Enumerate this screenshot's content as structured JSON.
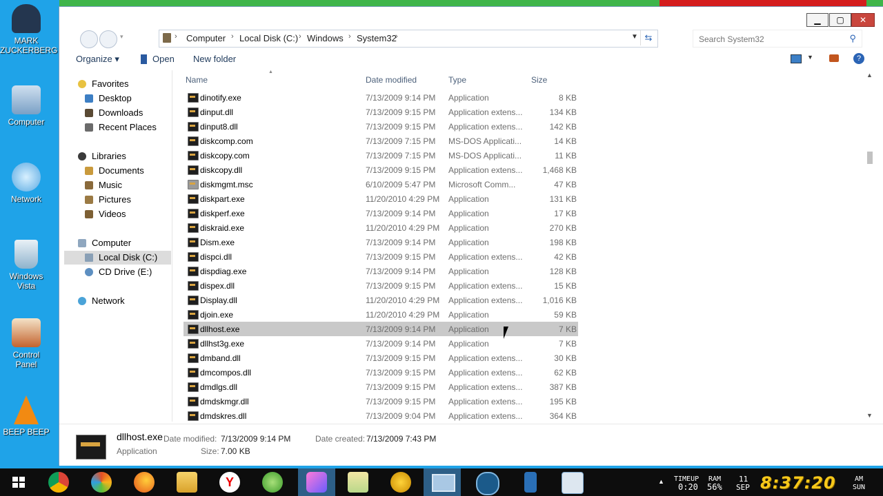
{
  "desktop": {
    "icons": [
      {
        "label": "MARK\nZUCKERBERG",
        "icon": "person-icon"
      },
      {
        "label": "Computer",
        "icon": "computer-icon"
      },
      {
        "label": "Network",
        "icon": "network-icon"
      },
      {
        "label": "Windows\nVista",
        "icon": "recycle-bin-icon"
      },
      {
        "label": "Control\nPanel",
        "icon": "control-panel-icon"
      },
      {
        "label": "BEEP BEEP",
        "icon": "cone-icon"
      }
    ]
  },
  "window": {
    "buttons": {
      "minimize": "▁",
      "maximize": "▢",
      "close": "✕"
    },
    "breadcrumb": [
      "Computer",
      "Local Disk (C:)",
      "Windows",
      "System32"
    ],
    "search_placeholder": "Search System32",
    "toolbar": {
      "organize": "Organize ▾",
      "open": "Open",
      "new_folder": "New folder"
    }
  },
  "sidebar": {
    "items": [
      {
        "label": "Favorites",
        "icon": "star-icon",
        "indent": 0
      },
      {
        "label": "Desktop",
        "icon": "desktop-icon",
        "indent": 1
      },
      {
        "label": "Downloads",
        "icon": "downloads-icon",
        "indent": 1
      },
      {
        "label": "Recent Places",
        "icon": "recent-places-icon",
        "indent": 1
      },
      {
        "label": "Libraries",
        "icon": "libraries-icon",
        "indent": 0
      },
      {
        "label": "Documents",
        "icon": "documents-icon",
        "indent": 1
      },
      {
        "label": "Music",
        "icon": "music-icon",
        "indent": 1
      },
      {
        "label": "Pictures",
        "icon": "pictures-icon",
        "indent": 1
      },
      {
        "label": "Videos",
        "icon": "videos-icon",
        "indent": 1
      },
      {
        "label": "Computer",
        "icon": "computer-icon",
        "indent": 0
      },
      {
        "label": "Local Disk (C:)",
        "icon": "drive-icon",
        "indent": 1,
        "selected": true
      },
      {
        "label": "CD Drive (E:)",
        "icon": "cd-drive-icon",
        "indent": 1
      },
      {
        "label": "Network",
        "icon": "network-icon",
        "indent": 0
      }
    ]
  },
  "columns": {
    "name": "Name",
    "date": "Date modified",
    "type": "Type",
    "size": "Size"
  },
  "files": [
    {
      "name": "dinotify.exe",
      "date": "7/13/2009 9:14 PM",
      "type": "Application",
      "size": "8 KB"
    },
    {
      "name": "dinput.dll",
      "date": "7/13/2009 9:15 PM",
      "type": "Application extens...",
      "size": "134 KB"
    },
    {
      "name": "dinput8.dll",
      "date": "7/13/2009 9:15 PM",
      "type": "Application extens...",
      "size": "142 KB"
    },
    {
      "name": "diskcomp.com",
      "date": "7/13/2009 7:15 PM",
      "type": "MS-DOS Applicati...",
      "size": "14 KB"
    },
    {
      "name": "diskcopy.com",
      "date": "7/13/2009 7:15 PM",
      "type": "MS-DOS Applicati...",
      "size": "11 KB"
    },
    {
      "name": "diskcopy.dll",
      "date": "7/13/2009 9:15 PM",
      "type": "Application extens...",
      "size": "1,468 KB"
    },
    {
      "name": "diskmgmt.msc",
      "date": "6/10/2009 5:47 PM",
      "type": "Microsoft Comm...",
      "size": "47 KB"
    },
    {
      "name": "diskpart.exe",
      "date": "11/20/2010 4:29 PM",
      "type": "Application",
      "size": "131 KB"
    },
    {
      "name": "diskperf.exe",
      "date": "7/13/2009 9:14 PM",
      "type": "Application",
      "size": "17 KB"
    },
    {
      "name": "diskraid.exe",
      "date": "11/20/2010 4:29 PM",
      "type": "Application",
      "size": "270 KB"
    },
    {
      "name": "Dism.exe",
      "date": "7/13/2009 9:14 PM",
      "type": "Application",
      "size": "198 KB"
    },
    {
      "name": "dispci.dll",
      "date": "7/13/2009 9:15 PM",
      "type": "Application extens...",
      "size": "42 KB"
    },
    {
      "name": "dispdiag.exe",
      "date": "7/13/2009 9:14 PM",
      "type": "Application",
      "size": "128 KB"
    },
    {
      "name": "dispex.dll",
      "date": "7/13/2009 9:15 PM",
      "type": "Application extens...",
      "size": "15 KB"
    },
    {
      "name": "Display.dll",
      "date": "11/20/2010 4:29 PM",
      "type": "Application extens...",
      "size": "1,016 KB"
    },
    {
      "name": "djoin.exe",
      "date": "11/20/2010 4:29 PM",
      "type": "Application",
      "size": "59 KB"
    },
    {
      "name": "dllhost.exe",
      "date": "7/13/2009 9:14 PM",
      "type": "Application",
      "size": "7 KB",
      "selected": true
    },
    {
      "name": "dllhst3g.exe",
      "date": "7/13/2009 9:14 PM",
      "type": "Application",
      "size": "7 KB"
    },
    {
      "name": "dmband.dll",
      "date": "7/13/2009 9:15 PM",
      "type": "Application extens...",
      "size": "30 KB"
    },
    {
      "name": "dmcompos.dll",
      "date": "7/13/2009 9:15 PM",
      "type": "Application extens...",
      "size": "62 KB"
    },
    {
      "name": "dmdlgs.dll",
      "date": "7/13/2009 9:15 PM",
      "type": "Application extens...",
      "size": "387 KB"
    },
    {
      "name": "dmdskmgr.dll",
      "date": "7/13/2009 9:15 PM",
      "type": "Application extens...",
      "size": "195 KB"
    },
    {
      "name": "dmdskres.dll",
      "date": "7/13/2009 9:04 PM",
      "type": "Application extens...",
      "size": "364 KB"
    }
  ],
  "details": {
    "name": "dllhost.exe",
    "type": "Application",
    "modified_label": "Date modified:",
    "modified": "7/13/2009 9:14 PM",
    "created_label": "Date created:",
    "created": "7/13/2009 7:43 PM",
    "size_label": "Size:",
    "size": "7.00 KB"
  },
  "taskbar": {
    "apps": [
      "start-icon",
      "chrome-icon",
      "browser-icon",
      "firefox-icon",
      "explorer-folder-icon",
      "yandex-icon",
      "greenshot-icon",
      "crystal-icon",
      "folder-icon",
      "yahoo-icon",
      "screen-icon",
      "speed-icon",
      "phone-icon",
      "taskmanager-icon"
    ],
    "timeup_label": "TIMEUP",
    "timeup": "0:20",
    "ram_label": "RAM",
    "ram": "56%",
    "day": "11",
    "month": "SEP",
    "ampm": "AM",
    "weekday": "SUN",
    "clock": "8:37:20"
  },
  "colors": {
    "accent": "#2b64b5",
    "selected_row": "#c9c9c9",
    "clock": "#f6c81a",
    "close": "#c9463d"
  }
}
